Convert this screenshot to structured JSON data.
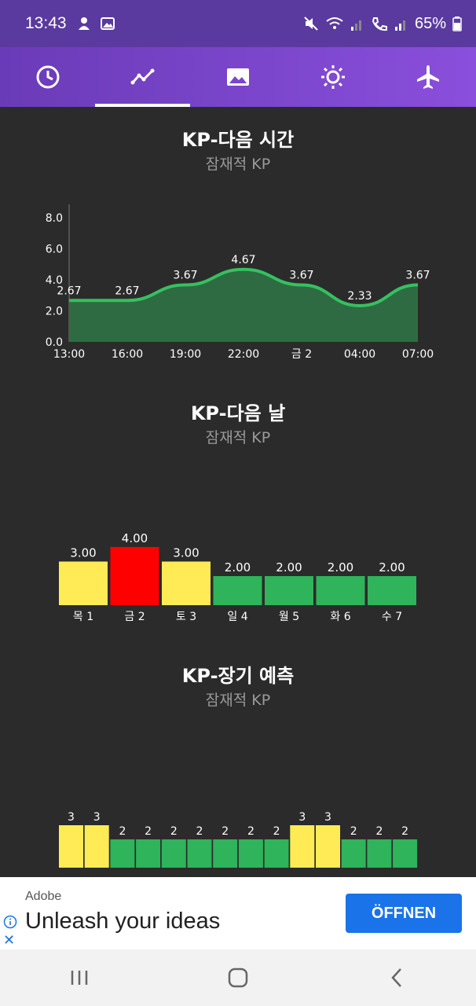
{
  "status_bar": {
    "time": "13:43",
    "battery": "65%"
  },
  "tabs": [
    {
      "name": "clock",
      "active": false
    },
    {
      "name": "trend",
      "active": true
    },
    {
      "name": "image",
      "active": false
    },
    {
      "name": "sun",
      "active": false
    },
    {
      "name": "airplane",
      "active": false
    }
  ],
  "section1": {
    "title": "KP-다음 시간",
    "subtitle": "잠재적 KP"
  },
  "section2": {
    "title": "KP-다음 날",
    "subtitle": "잠재적 KP"
  },
  "section3": {
    "title": "KP-장기 예측",
    "subtitle": "잠재적 KP"
  },
  "chart_data": [
    {
      "type": "area",
      "y_ticks": [
        "8.0",
        "6.0",
        "4.0",
        "2.0",
        "0.0"
      ],
      "ylim": [
        0,
        8
      ],
      "categories": [
        "13:00",
        "16:00",
        "19:00",
        "22:00",
        "금 2",
        "04:00",
        "07:00"
      ],
      "values": [
        2.67,
        2.67,
        3.67,
        4.67,
        3.67,
        2.33,
        3.67
      ],
      "value_labels": [
        "2.67",
        "2.67",
        "3.67",
        "4.67",
        "3.67",
        "2.33",
        "3.67"
      ],
      "colors": {
        "line": "#36c060",
        "fill": "#2e6b42"
      }
    },
    {
      "type": "bar",
      "categories": [
        "목 1",
        "금 2",
        "토 3",
        "일 4",
        "월 5",
        "화 6",
        "수 7"
      ],
      "values": [
        3.0,
        4.0,
        3.0,
        2.0,
        2.0,
        2.0,
        2.0
      ],
      "value_labels": [
        "3.00",
        "4.00",
        "3.00",
        "2.00",
        "2.00",
        "2.00",
        "2.00"
      ],
      "colors": [
        "#ffeb55",
        "#ff0000",
        "#ffeb55",
        "#2fb35b",
        "#2fb35b",
        "#2fb35b",
        "#2fb35b"
      ]
    },
    {
      "type": "bar",
      "values": [
        3,
        3,
        2,
        2,
        2,
        2,
        2,
        2,
        2,
        3,
        3,
        2,
        2,
        2
      ],
      "value_labels": [
        "3",
        "3",
        "2",
        "2",
        "2",
        "2",
        "2",
        "2",
        "2",
        "3",
        "3",
        "2",
        "2",
        "2"
      ],
      "colors": [
        "#ffeb55",
        "#ffeb55",
        "#2fb35b",
        "#2fb35b",
        "#2fb35b",
        "#2fb35b",
        "#2fb35b",
        "#2fb35b",
        "#2fb35b",
        "#ffeb55",
        "#ffeb55",
        "#2fb35b",
        "#2fb35b",
        "#2fb35b"
      ]
    }
  ],
  "ad": {
    "brand": "Adobe",
    "headline": "Unleash your ideas",
    "cta": "ÖFFNEN"
  }
}
